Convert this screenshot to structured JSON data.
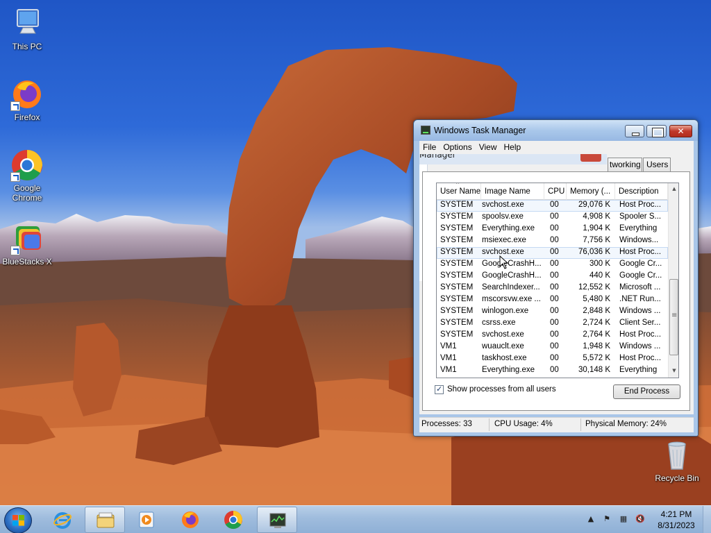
{
  "desktop": {
    "icons": [
      {
        "label": "This PC",
        "icon": "computer-icon"
      },
      {
        "label": "Firefox",
        "icon": "firefox-icon"
      },
      {
        "label": "Google Chrome",
        "icon": "chrome-icon"
      },
      {
        "label": "BlueStacks X",
        "icon": "bluestacks-icon"
      },
      {
        "label": "Recycle Bin",
        "icon": "recycle-bin-icon"
      }
    ]
  },
  "task_manager": {
    "title": "Windows Task Manager",
    "menu": [
      "File",
      "Options",
      "View",
      "Help"
    ],
    "ghost_text": "Manager",
    "tabs": [
      "tworking",
      "Users"
    ],
    "columns": [
      "User Name",
      "Image Name",
      "CPU",
      "Memory (...",
      "Description"
    ],
    "rows": [
      {
        "user": "SYSTEM",
        "image": "svchost.exe",
        "cpu": "00",
        "mem": "29,076 K",
        "desc": "Host Proc..."
      },
      {
        "user": "SYSTEM",
        "image": "spoolsv.exe",
        "cpu": "00",
        "mem": "4,908 K",
        "desc": "Spooler S..."
      },
      {
        "user": "SYSTEM",
        "image": "Everything.exe",
        "cpu": "00",
        "mem": "1,904 K",
        "desc": "Everything"
      },
      {
        "user": "SYSTEM",
        "image": "msiexec.exe",
        "cpu": "00",
        "mem": "7,756 K",
        "desc": "Windows..."
      },
      {
        "user": "SYSTEM",
        "image": "svchost.exe",
        "cpu": "00",
        "mem": "76,036 K",
        "desc": "Host Proc..."
      },
      {
        "user": "SYSTEM",
        "image": "GoogleCrashH...",
        "cpu": "00",
        "mem": "300 K",
        "desc": "Google Cr..."
      },
      {
        "user": "SYSTEM",
        "image": "GoogleCrashH...",
        "cpu": "00",
        "mem": "440 K",
        "desc": "Google Cr..."
      },
      {
        "user": "SYSTEM",
        "image": "SearchIndexer...",
        "cpu": "00",
        "mem": "12,552 K",
        "desc": "Microsoft ..."
      },
      {
        "user": "SYSTEM",
        "image": "mscorsvw.exe ...",
        "cpu": "00",
        "mem": "5,480 K",
        "desc": ".NET Run..."
      },
      {
        "user": "SYSTEM",
        "image": "winlogon.exe",
        "cpu": "00",
        "mem": "2,848 K",
        "desc": "Windows ..."
      },
      {
        "user": "SYSTEM",
        "image": "csrss.exe",
        "cpu": "00",
        "mem": "2,724 K",
        "desc": "Client Ser..."
      },
      {
        "user": "SYSTEM",
        "image": "svchost.exe",
        "cpu": "00",
        "mem": "2,764 K",
        "desc": "Host Proc..."
      },
      {
        "user": "VM1",
        "image": "wuauclt.exe",
        "cpu": "00",
        "mem": "1,948 K",
        "desc": "Windows ..."
      },
      {
        "user": "VM1",
        "image": "taskhost.exe",
        "cpu": "00",
        "mem": "5,572 K",
        "desc": "Host Proc..."
      },
      {
        "user": "VM1",
        "image": "Everything.exe",
        "cpu": "00",
        "mem": "30,148 K",
        "desc": "Everything"
      }
    ],
    "selected_rows": [
      0,
      4
    ],
    "show_all_label": "Show processes from all users",
    "show_all_checked": true,
    "end_process_label": "End Process",
    "status": {
      "processes": "Processes: 33",
      "cpu": "CPU Usage: 4%",
      "memory": "Physical Memory: 24%"
    }
  },
  "taskbar": {
    "pinned": [
      "start-orb",
      "internet-explorer-icon",
      "file-explorer-icon",
      "media-player-icon",
      "firefox-icon",
      "chrome-icon",
      "task-manager-icon"
    ],
    "active": [
      "file-explorer-icon",
      "task-manager-icon"
    ],
    "clock": {
      "time": "4:21 PM",
      "date": "8/31/2023"
    }
  },
  "colors": {
    "sky": "#1f56c6",
    "rock": "#b4532a",
    "window_frame": "#a9c6e8",
    "close_red": "#c0392b"
  }
}
